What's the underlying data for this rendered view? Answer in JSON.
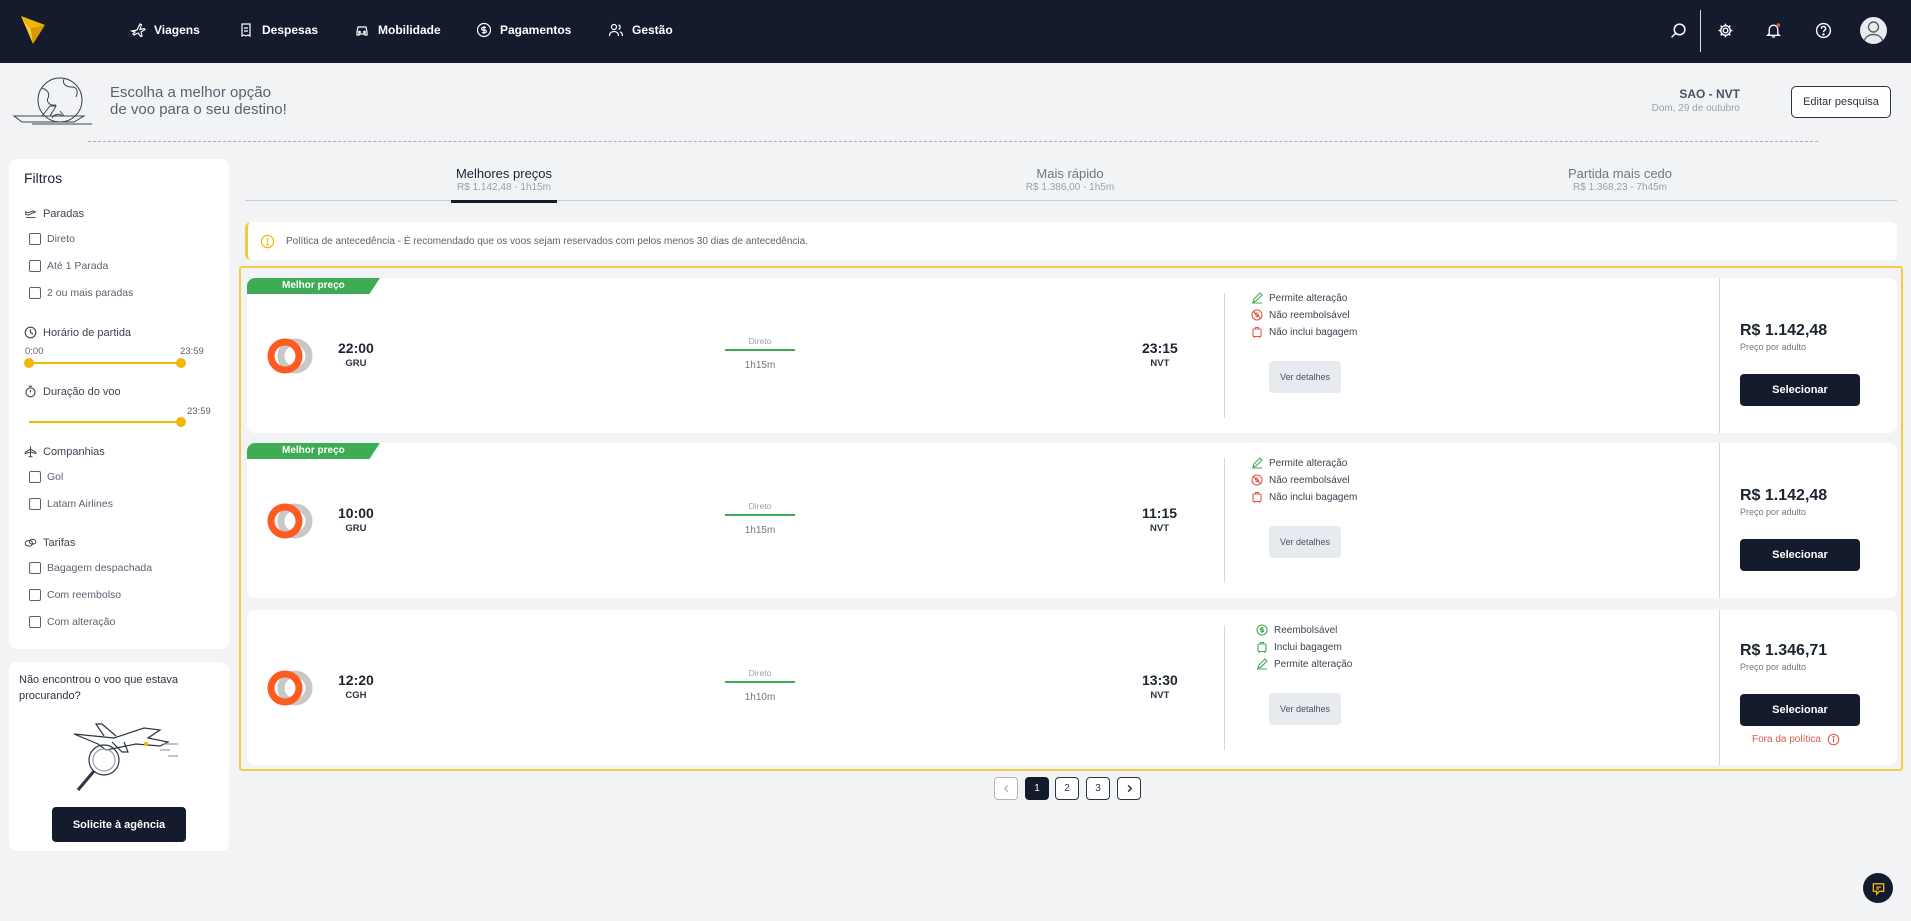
{
  "nav": {
    "items": [
      {
        "label": "Viagens",
        "icon": "plane-icon"
      },
      {
        "label": "Despesas",
        "icon": "receipt-icon"
      },
      {
        "label": "Mobilidade",
        "icon": "car-icon"
      },
      {
        "label": "Pagamentos",
        "icon": "dollar-circle-icon"
      },
      {
        "label": "Gestão",
        "icon": "users-icon"
      }
    ],
    "right_icons": [
      "search-icon",
      "gear-icon",
      "bell-icon",
      "help-icon",
      "avatar"
    ],
    "accent": "#f2b705"
  },
  "header": {
    "line1": "Escolha a melhor opção",
    "line2": "de voo para o seu destino!",
    "route": "SAO - NVT",
    "date": "Dom, 29 de outubro",
    "edit_label": "Editar pesquisa"
  },
  "filters": {
    "title": "Filtros",
    "stops": {
      "title": "Paradas",
      "options": [
        "Direto",
        "Até 1 Parada",
        "2 ou mais paradas"
      ]
    },
    "departure": {
      "title": "Horário de partida",
      "min": "0:00",
      "max": "23:59"
    },
    "duration": {
      "title": "Duração do voo",
      "max": "23:59"
    },
    "airlines": {
      "title": "Companhias",
      "options": [
        "Gol",
        "Latam Airlines"
      ]
    },
    "fares": {
      "title": "Tarifas",
      "options": [
        "Bagagem despachada",
        "Com reembolso",
        "Com alteração"
      ]
    }
  },
  "notfound": {
    "text": "Não encontrou o voo que estava procurando?",
    "button": "Solicite à agência"
  },
  "tabs": [
    {
      "label": "Melhores preços",
      "sub": "R$ 1.142,48 - 1h15m",
      "active": true
    },
    {
      "label": "Mais rápido",
      "sub": "R$ 1.386,00 - 1h5m",
      "active": false
    },
    {
      "label": "Partida mais cedo",
      "sub": "R$ 1.368,23 - 7h45m",
      "active": false
    }
  ],
  "policy": "Política de antecedência - É recomendado que os voos sejam reservados com pelos menos 30 dias de antecedência.",
  "flights": [
    {
      "badge": "Melhor preço",
      "dep_time": "22:00",
      "dep_airport": "GRU",
      "stops": "Direto",
      "duration": "1h15m",
      "arr_time": "23:15",
      "arr_airport": "NVT",
      "conditions": [
        {
          "text": "Permite alteração",
          "icon": "edit-icon",
          "color": "#3eab55"
        },
        {
          "text": "Não reembolsável",
          "icon": "no-refund-icon",
          "color": "#e2554a"
        },
        {
          "text": "Não inclui bagagem",
          "icon": "luggage-icon",
          "color": "#e2554a"
        }
      ],
      "details": "Ver detalhes",
      "price": "R$ 1.142,48",
      "price_note": "Preço por adulto",
      "select": "Selecionar"
    },
    {
      "badge": "Melhor preço",
      "dep_time": "10:00",
      "dep_airport": "GRU",
      "stops": "Direto",
      "duration": "1h15m",
      "arr_time": "11:15",
      "arr_airport": "NVT",
      "conditions": [
        {
          "text": "Permite alteração",
          "icon": "edit-icon",
          "color": "#3eab55"
        },
        {
          "text": "Não reembolsável",
          "icon": "no-refund-icon",
          "color": "#e2554a"
        },
        {
          "text": "Não inclui bagagem",
          "icon": "luggage-icon",
          "color": "#e2554a"
        }
      ],
      "details": "Ver detalhes",
      "price": "R$ 1.142,48",
      "price_note": "Preço por adulto",
      "select": "Selecionar"
    },
    {
      "badge": "",
      "dep_time": "12:20",
      "dep_airport": "CGH",
      "stops": "Direto",
      "duration": "1h10m",
      "arr_time": "13:30",
      "arr_airport": "NVT",
      "conditions": [
        {
          "text": "Reembolsável",
          "icon": "refund-icon",
          "color": "#3eab55"
        },
        {
          "text": "Inclui bagagem",
          "icon": "luggage-icon",
          "color": "#3eab55"
        },
        {
          "text": "Permite alteração",
          "icon": "edit-icon",
          "color": "#3eab55"
        }
      ],
      "details": "Ver detalhes",
      "price": "R$ 1.346,71",
      "price_note": "Preço por adulto",
      "select": "Selecionar",
      "out_of_policy": "Fora da política"
    }
  ],
  "pagination": {
    "pages": [
      "1",
      "2",
      "3"
    ],
    "current": "1"
  }
}
